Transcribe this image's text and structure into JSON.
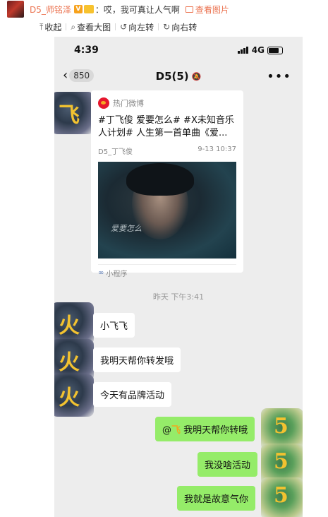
{
  "comment": {
    "username": "D5_师铭泽",
    "vip_badge": "V",
    "text": "：哎，我可真让人气啊",
    "view_picture": "查看图片"
  },
  "toolbar": {
    "collapse": "收起",
    "view_large": "查看大图",
    "rotate_left": "向左转",
    "rotate_right": "向右转"
  },
  "phone": {
    "status": {
      "time": "4:39",
      "network": "4G"
    },
    "nav": {
      "back_count": "850",
      "title": "D5(5)",
      "more": "•••"
    },
    "avatars": {
      "left_glyph": "飞",
      "hui_glyph": "火",
      "right_glyph": "5"
    },
    "mini_program": {
      "source": "热门微博",
      "title": "#丁飞俊 爱要怎么# #X未知音乐人计划# 人生第一首单曲《爱...",
      "author": "D5_丁飞俊",
      "date": "9-13 10:37",
      "image_caption": "爱要怎么",
      "footer": "小程序"
    },
    "timestamp": "昨天 下午3:41",
    "messages": [
      {
        "side": "left",
        "text": "小飞飞"
      },
      {
        "side": "left",
        "text": "我明天帮你转发哦"
      },
      {
        "side": "left",
        "text": "今天有品牌活动"
      },
      {
        "side": "right",
        "prefix": "@",
        "mention_mark": "飞",
        "text": " 我明天帮你转哦"
      },
      {
        "side": "right",
        "text": "我没啥活动"
      },
      {
        "side": "right",
        "text": "我就是故意气你"
      }
    ]
  },
  "colors": {
    "accent": "#eb7350",
    "chat_bg": "#ededed",
    "self_bubble": "#95ec69",
    "weibo_red": "#e6162d"
  },
  "icons": [
    "pic-icon",
    "collapse-icon",
    "search-icon",
    "rotate-left-icon",
    "rotate-right-icon",
    "signal-icon",
    "battery-icon",
    "back-chevron-icon",
    "mute-icon",
    "more-icon",
    "weibo-logo-icon",
    "mini-program-icon"
  ]
}
